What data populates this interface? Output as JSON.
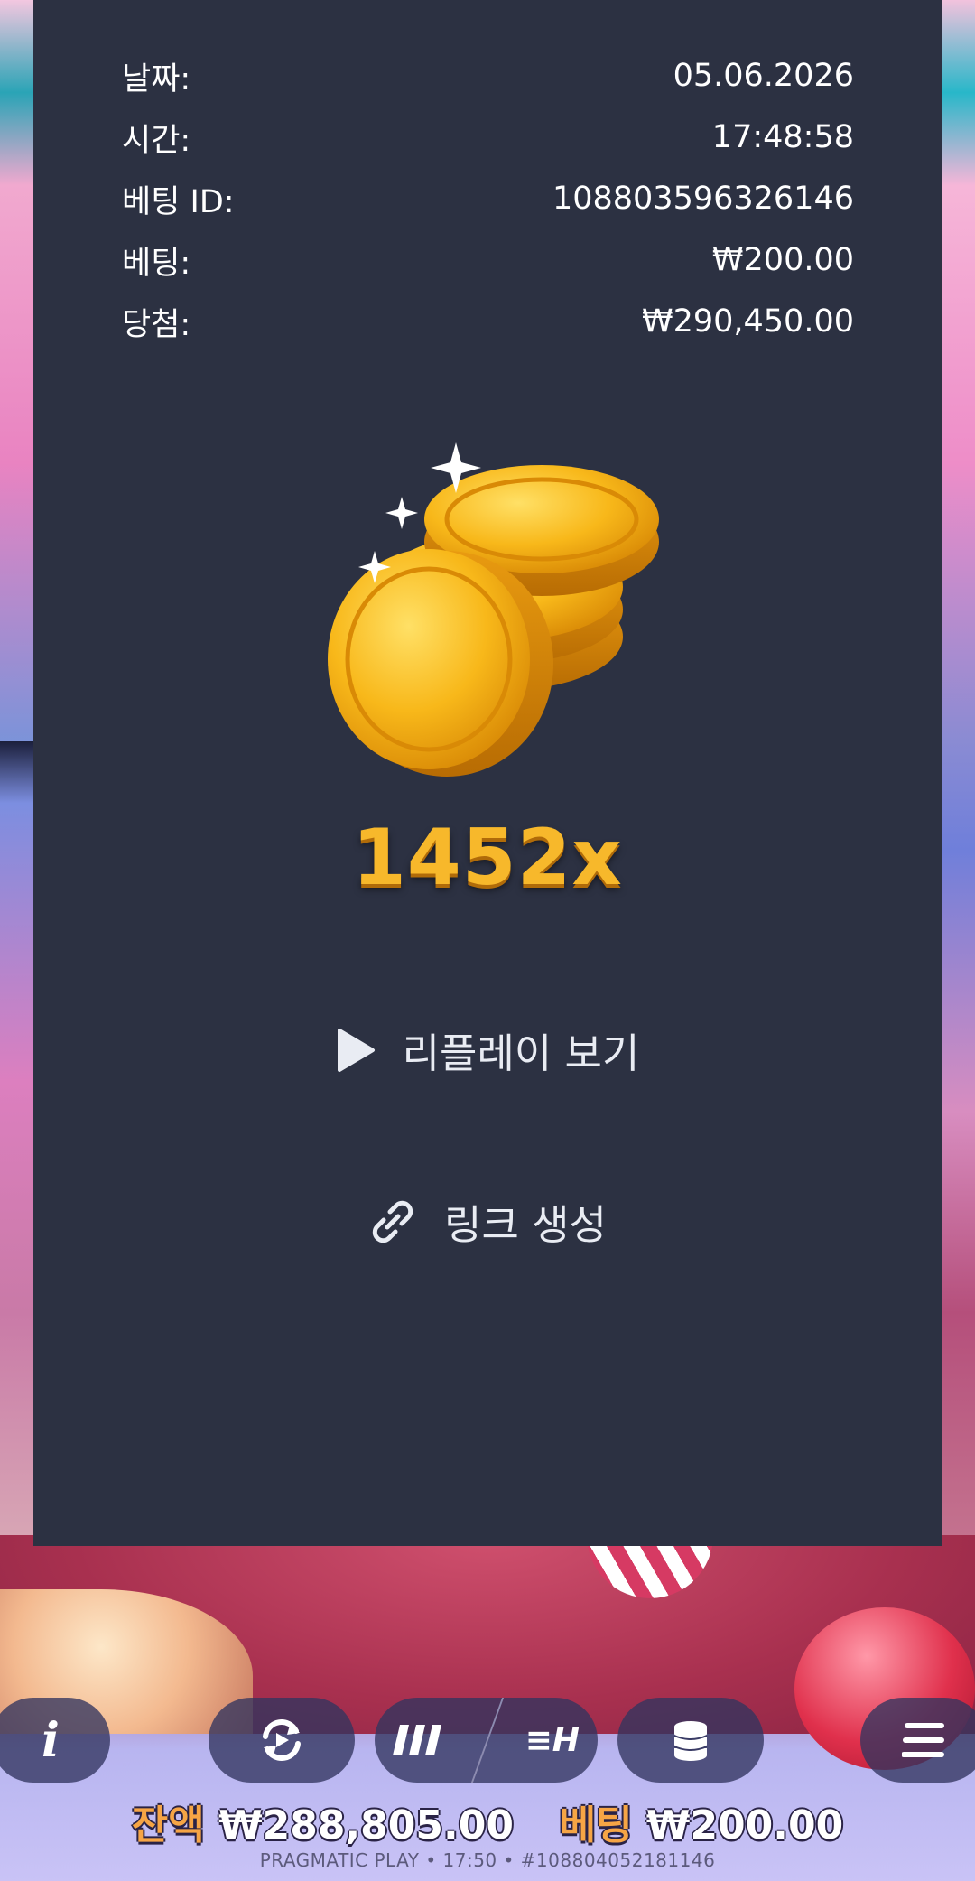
{
  "bet_details": {
    "rows": [
      {
        "label": "날짜:",
        "value": "05.06.2026"
      },
      {
        "label": "시간:",
        "value": "17:48:58"
      },
      {
        "label": "베팅 ID:",
        "value": "108803596326146"
      },
      {
        "label": "베팅:",
        "value": "₩200.00"
      },
      {
        "label": "당첨:",
        "value": "₩290,450.00"
      }
    ],
    "multiplier": "1452x"
  },
  "actions": {
    "replay_label": "리플레이 보기",
    "link_label": "링크 생성"
  },
  "status_bar": {
    "balance_label": "잔액",
    "balance_value": "₩288,805.00",
    "bet_label": "베팅",
    "bet_value": "₩200.00"
  },
  "footer": {
    "text": "PRAGMATIC PLAY • 17:50 • #108804052181146"
  },
  "colors": {
    "panel_bg": "#2c3142",
    "multiplier": "#f7b82b",
    "status_label": "#f6a545"
  },
  "icons": [
    "play-icon",
    "link-icon",
    "info-icon",
    "autoplay-icon",
    "turbo-icon",
    "hyper-icon",
    "coins-stack-icon",
    "menu-icon",
    "gold-coins-icon"
  ]
}
